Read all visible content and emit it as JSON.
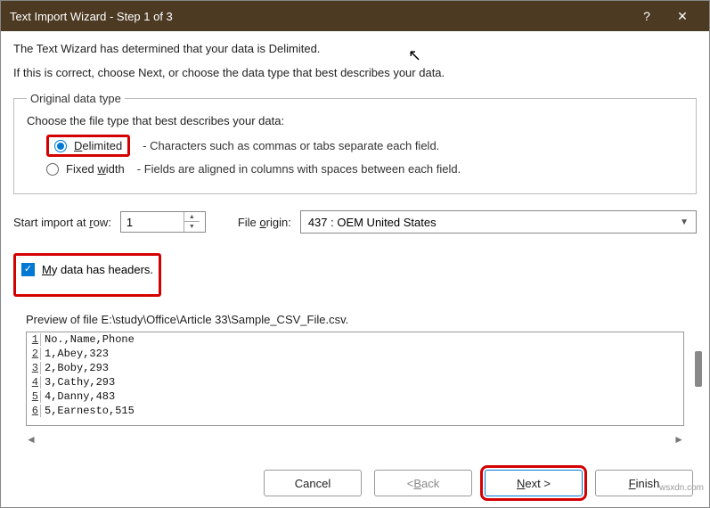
{
  "titlebar": {
    "title": "Text Import Wizard - Step 1 of 3",
    "help": "?",
    "close": "✕"
  },
  "intro": {
    "line1": "The Text Wizard has determined that your data is Delimited.",
    "line2": "If this is correct, choose Next, or choose the data type that best describes your data."
  },
  "group": {
    "legend": "Original data type",
    "choose": "Choose the file type that best describes your data:",
    "delimited": {
      "label": "Delimited",
      "desc": "- Characters such as commas or tabs separate each field."
    },
    "fixed": {
      "label": "Fixed width",
      "desc": "- Fields are aligned in columns with spaces between each field."
    }
  },
  "start_row": {
    "label": "Start import at row:",
    "value": "1"
  },
  "origin": {
    "label": "File origin:",
    "value": "437 : OEM United States"
  },
  "headers": {
    "label": "My data has headers."
  },
  "preview": {
    "label": "Preview of file E:\\study\\Office\\Article 33\\Sample_CSV_File.csv.",
    "rows": [
      {
        "n": "1",
        "t": "No.,Name,Phone"
      },
      {
        "n": "2",
        "t": "1,Abey,323"
      },
      {
        "n": "3",
        "t": "2,Boby,293"
      },
      {
        "n": "4",
        "t": "3,Cathy,293"
      },
      {
        "n": "5",
        "t": "4,Danny,483"
      },
      {
        "n": "6",
        "t": "5,Earnesto,515"
      }
    ]
  },
  "buttons": {
    "cancel": "Cancel",
    "back": "< Back",
    "next": "Next >",
    "finish": "Finish"
  },
  "watermark": "wsxdn.com"
}
